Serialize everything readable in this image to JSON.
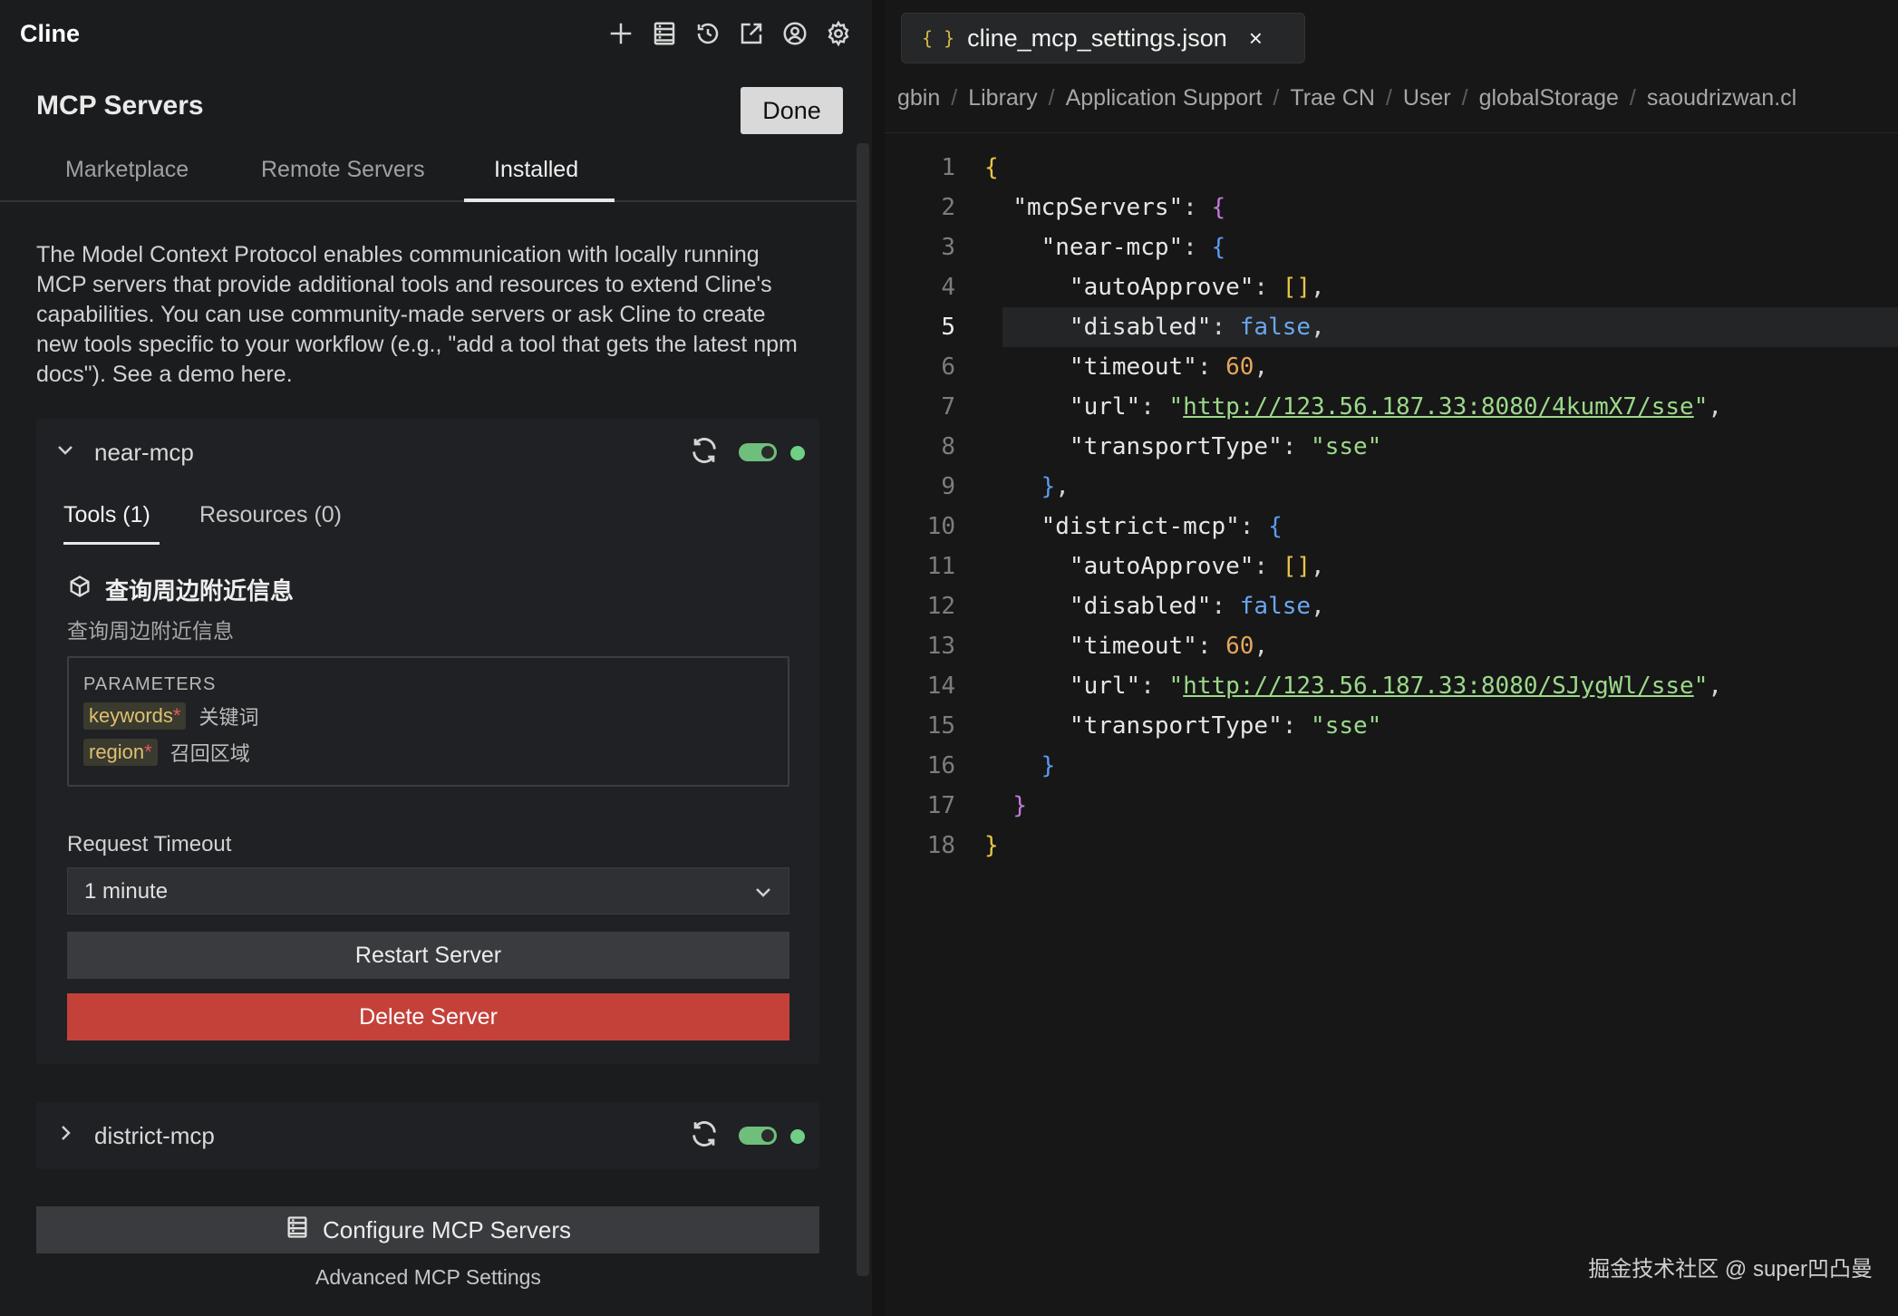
{
  "app": {
    "title": "Cline",
    "toolbar_icons": [
      "plus-icon",
      "server-list-icon",
      "history-icon",
      "popout-icon",
      "account-icon",
      "gear-icon"
    ]
  },
  "mcp": {
    "header": "MCP Servers",
    "done_label": "Done",
    "tabs": [
      "Marketplace",
      "Remote Servers",
      "Installed"
    ],
    "active_tab": "Installed",
    "description": "The Model Context Protocol enables communication with locally running MCP servers that provide additional tools and resources to extend Cline's capabilities. You can use community-made servers or ask Cline to create new tools specific to your workflow (e.g., \"add a tool that gets the latest npm docs\"). See a demo here.",
    "servers": [
      {
        "name": "near-mcp",
        "expanded": true,
        "enabled": true,
        "status_color": "#6fcf85",
        "subtabs": [
          "Tools (1)",
          "Resources (0)"
        ],
        "tool": {
          "name": "查询周边附近信息",
          "description": "查询周边附近信息",
          "params_title": "PARAMETERS",
          "params": [
            {
              "name": "keywords",
              "required_mark": "*",
              "desc": "关键词"
            },
            {
              "name": "region",
              "required_mark": "*",
              "desc": "召回区域"
            }
          ]
        },
        "timeout_label": "Request Timeout",
        "timeout_value": "1 minute",
        "restart_label": "Restart Server",
        "delete_label": "Delete Server"
      },
      {
        "name": "district-mcp",
        "expanded": false,
        "enabled": true,
        "status_color": "#6fcf85"
      }
    ],
    "configure_label": "Configure MCP Servers",
    "advanced_label": "Advanced MCP Settings"
  },
  "editor": {
    "tab_icon": "{ }",
    "file_name": "cline_mcp_settings.json",
    "close_glyph": "×",
    "breadcrumbs": [
      "gbin",
      "Library",
      "Application Support",
      "Trae CN",
      "User",
      "globalStorage",
      "saoudrizwan.cl"
    ],
    "active_line": 5,
    "line_numbers": [
      "1",
      "2",
      "3",
      "4",
      "5",
      "6",
      "7",
      "8",
      "9",
      "10",
      "11",
      "12",
      "13",
      "14",
      "15",
      "16",
      "17",
      "18"
    ],
    "values": {
      "near_url": "http://123.56.187.33:8080/4kumX7/sse",
      "district_url": "http://123.56.187.33:8080/SJygWl/sse",
      "timeout": "60",
      "disabled": "false",
      "transport": "sse"
    }
  },
  "watermark": "掘金技术社区 @ super凹凸曼"
}
